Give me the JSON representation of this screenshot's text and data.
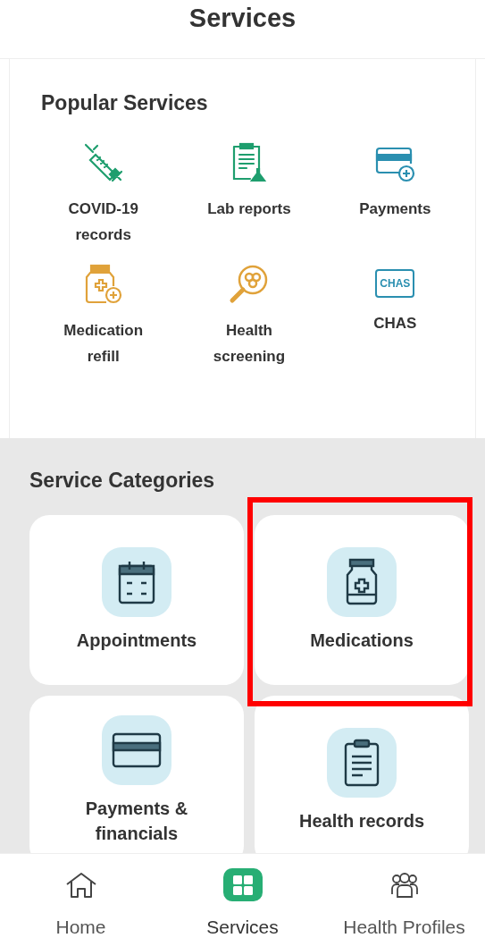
{
  "header": {
    "title": "Services"
  },
  "popular": {
    "title": "Popular Services",
    "items": [
      {
        "label": "COVID-19\nrecords",
        "kind": "syringe"
      },
      {
        "label": "Lab reports",
        "kind": "lab"
      },
      {
        "label": "Payments",
        "kind": "payment"
      },
      {
        "label": "Medication\nrefill",
        "kind": "refill"
      },
      {
        "label": "Health\nscreening",
        "kind": "screening"
      },
      {
        "label": "CHAS",
        "kind": "chas",
        "icon_text": "CHAS"
      }
    ]
  },
  "categories": {
    "title": "Service Categories",
    "items": [
      {
        "label": "Appointments",
        "kind": "calendar",
        "highlighted": false
      },
      {
        "label": "Medications",
        "kind": "bottle",
        "highlighted": true
      },
      {
        "label": "Payments &\nfinancials",
        "kind": "card",
        "highlighted": false
      },
      {
        "label": "Health records",
        "kind": "clipboard",
        "highlighted": false
      }
    ]
  },
  "nav": [
    {
      "label": "Home",
      "kind": "home",
      "selected": false
    },
    {
      "label": "Services",
      "kind": "grid",
      "selected": true
    },
    {
      "label": "Health Profiles",
      "kind": "people",
      "selected": false
    }
  ]
}
